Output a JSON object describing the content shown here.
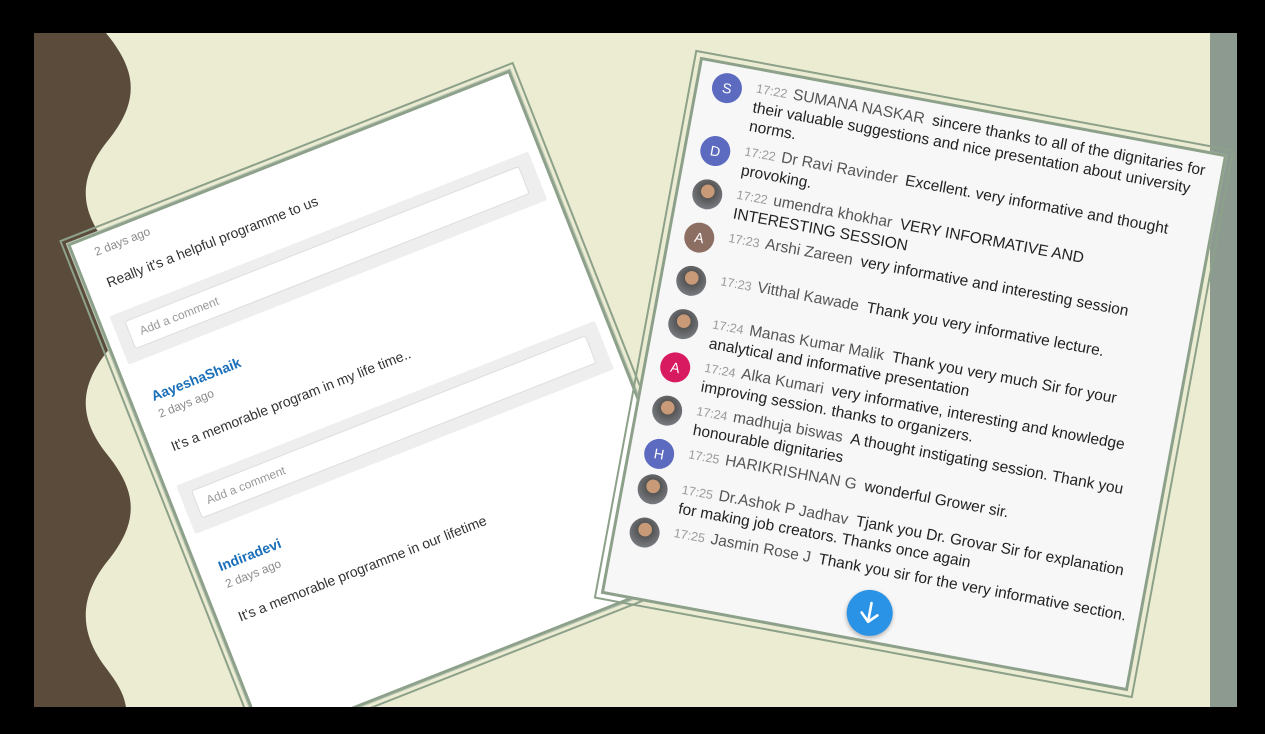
{
  "left_card": {
    "comments": [
      {
        "author": "",
        "ago": "2 days ago",
        "text": "Really it's a helpful programme to us"
      },
      {
        "author": "AayeshaShaik",
        "ago": "2 days ago",
        "text": "It's a memorable program in my life time.."
      },
      {
        "author": "Indiradevi",
        "ago": "2 days ago",
        "text": "It's a memorable programme in our lifetime"
      }
    ],
    "add_comment_placeholder": "Add a comment"
  },
  "chat": {
    "messages": [
      {
        "time": "17:22",
        "name": "SUMANA NASKAR",
        "text": "sincere thanks to all of the dignitaries for their valuable suggestions and nice presentation about university norms.",
        "avatar": "S",
        "avatar_color": "#5c6bc0"
      },
      {
        "time": "17:22",
        "name": "Dr Ravi Ravinder",
        "text": "Excellent. very informative and thought provoking.",
        "avatar": "D",
        "avatar_color": "#5c6bc0"
      },
      {
        "time": "17:22",
        "name": "umendra khokhar",
        "text": "VERY INFORMATIVE AND INTERESTING SESSION",
        "avatar": "",
        "avatar_color": ""
      },
      {
        "time": "17:23",
        "name": "Arshi Zareen",
        "text": "very informative and interesting session",
        "avatar": "A",
        "avatar_color": "#8d6e63"
      },
      {
        "time": "17:23",
        "name": "Vitthal Kawade",
        "text": "Thank you very informative lecture.",
        "avatar": "",
        "avatar_color": ""
      },
      {
        "time": "17:24",
        "name": "Manas Kumar Malik",
        "text": "Thank you very much Sir for your analytical and informative presentation",
        "avatar": "",
        "avatar_color": ""
      },
      {
        "time": "17:24",
        "name": "Alka Kumari",
        "text": "very informative, interesting and knowledge improving session. thanks to organizers.",
        "avatar": "A",
        "avatar_color": "#d81b60"
      },
      {
        "time": "17:24",
        "name": "madhuja biswas",
        "text": "A thought instigating session. Thank you honourable dignitaries",
        "avatar": "",
        "avatar_color": ""
      },
      {
        "time": "17:25",
        "name": "HARIKRISHNAN G",
        "text": "wonderful Grower sir.",
        "avatar": "H",
        "avatar_color": "#5c6bc0"
      },
      {
        "time": "17:25",
        "name": "Dr.Ashok P Jadhav",
        "text": "Tjank you Dr. Grovar Sir for explanation for making job creators. Thanks once again",
        "avatar": "",
        "avatar_color": ""
      },
      {
        "time": "17:25",
        "name": "Jasmin Rose J",
        "text": "Thank you sir for the very informative section.",
        "avatar": "",
        "avatar_color": ""
      }
    ],
    "scroll_icon": "arrow-down-icon",
    "accent": "#2a93e6"
  }
}
